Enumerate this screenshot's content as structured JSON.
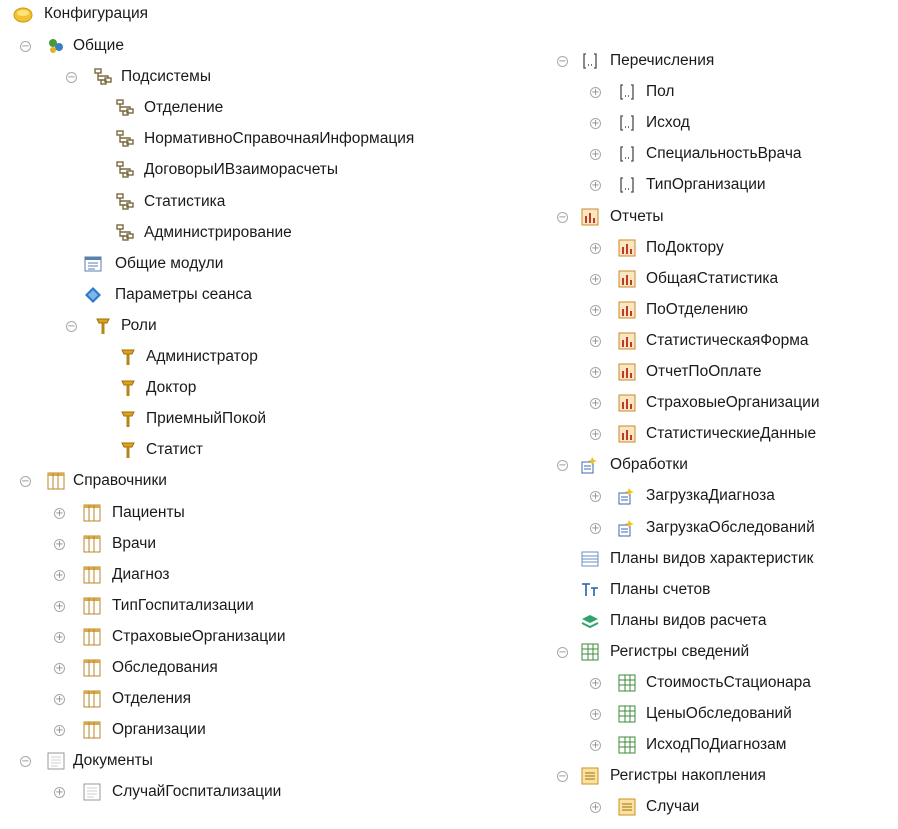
{
  "tree": {
    "root": {
      "label": "Конфигурация",
      "icon": "config-icon"
    },
    "left": [
      {
        "label": "Общие",
        "icon": "common-icon",
        "expanded": true
      },
      {
        "label": "Подсистемы",
        "icon": "subsystem-icon",
        "expanded": true
      },
      {
        "label": "Отделение",
        "icon": "subsystem-icon"
      },
      {
        "label": "НормативноСправочнаяИнформация",
        "icon": "subsystem-icon"
      },
      {
        "label": "ДоговорыИВзаиморасчеты",
        "icon": "subsystem-icon"
      },
      {
        "label": "Статистика",
        "icon": "subsystem-icon"
      },
      {
        "label": "Администрирование",
        "icon": "subsystem-icon"
      },
      {
        "label": "Общие модули",
        "icon": "common-module-icon"
      },
      {
        "label": "Параметры сеанса",
        "icon": "session-parameters-icon"
      },
      {
        "label": "Роли",
        "icon": "role-icon",
        "expanded": true
      },
      {
        "label": "Администратор",
        "icon": "role-icon"
      },
      {
        "label": "Доктор",
        "icon": "role-icon"
      },
      {
        "label": "ПриемныйПокой",
        "icon": "role-icon"
      },
      {
        "label": "Статист",
        "icon": "role-icon"
      },
      {
        "label": "Справочники",
        "icon": "catalog-icon",
        "expanded": true
      },
      {
        "label": "Пациенты",
        "icon": "catalog-icon",
        "expanded": false
      },
      {
        "label": "Врачи",
        "icon": "catalog-icon",
        "expanded": false
      },
      {
        "label": "Диагноз",
        "icon": "catalog-icon",
        "expanded": false
      },
      {
        "label": "ТипГоспитализации",
        "icon": "catalog-icon",
        "expanded": false
      },
      {
        "label": "СтраховыеОрганизации",
        "icon": "catalog-icon",
        "expanded": false
      },
      {
        "label": "Обследования",
        "icon": "catalog-icon",
        "expanded": false
      },
      {
        "label": "Отделения",
        "icon": "catalog-icon",
        "expanded": false
      },
      {
        "label": "Организации",
        "icon": "catalog-icon",
        "expanded": false
      },
      {
        "label": "Документы",
        "icon": "document-icon",
        "expanded": true
      },
      {
        "label": "СлучайГоспитализации",
        "icon": "document-icon",
        "expanded": false
      }
    ],
    "right": [
      {
        "label": "Перечисления",
        "icon": "enum-icon",
        "expanded": true
      },
      {
        "label": "Пол",
        "icon": "enum-icon",
        "expanded": false
      },
      {
        "label": "Исход",
        "icon": "enum-icon",
        "expanded": false
      },
      {
        "label": "СпециальностьВрача",
        "icon": "enum-icon",
        "expanded": false
      },
      {
        "label": "ТипОрганизации",
        "icon": "enum-icon",
        "expanded": false
      },
      {
        "label": "Отчеты",
        "icon": "report-icon",
        "expanded": true
      },
      {
        "label": "ПоДоктору",
        "icon": "report-icon",
        "expanded": false
      },
      {
        "label": "ОбщаяСтатистика",
        "icon": "report-icon",
        "expanded": false
      },
      {
        "label": "ПоОтделению",
        "icon": "report-icon",
        "expanded": false
      },
      {
        "label": "СтатистическаяФорма",
        "icon": "report-icon",
        "expanded": false
      },
      {
        "label": "ОтчетПоОплате",
        "icon": "report-icon",
        "expanded": false
      },
      {
        "label": "СтраховыеОрганизации",
        "icon": "report-icon",
        "expanded": false
      },
      {
        "label": "СтатистическиеДанные",
        "icon": "report-icon",
        "expanded": false
      },
      {
        "label": "Обработки",
        "icon": "data-processor-icon",
        "expanded": true
      },
      {
        "label": "ЗагрузкаДиагноза",
        "icon": "data-processor-icon",
        "expanded": false
      },
      {
        "label": "ЗагрузкаОбследований",
        "icon": "data-processor-icon",
        "expanded": false
      },
      {
        "label": "Планы видов характеристик",
        "icon": "chart-of-characteristic-types-icon"
      },
      {
        "label": "Планы счетов",
        "icon": "chart-of-accounts-icon"
      },
      {
        "label": "Планы видов расчета",
        "icon": "chart-of-calculation-types-icon"
      },
      {
        "label": "Регистры сведений",
        "icon": "information-register-icon",
        "expanded": true
      },
      {
        "label": "СтоимостьСтационара",
        "icon": "information-register-icon",
        "expanded": false
      },
      {
        "label": "ЦеныОбследований",
        "icon": "information-register-icon",
        "expanded": false
      },
      {
        "label": "ИсходПоДиагнозам",
        "icon": "information-register-icon",
        "expanded": false
      },
      {
        "label": "Регистры накопления",
        "icon": "accumulation-register-icon",
        "expanded": true
      },
      {
        "label": "Случаи",
        "icon": "accumulation-register-icon",
        "expanded": false
      }
    ]
  }
}
